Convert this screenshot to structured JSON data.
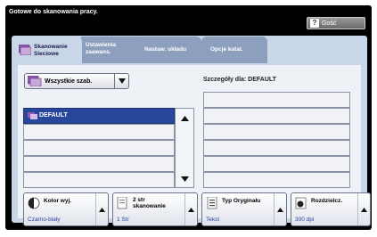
{
  "status_bar": {
    "message": "Gotowe do skanowania pracy.",
    "guest_button": "Gość",
    "guest_icon": "question-icon"
  },
  "tabs": [
    {
      "label_1": "Skanowanie",
      "label_2": "Sieciowe",
      "active": true
    },
    {
      "label_1": "Ustawienia",
      "label_2": "zaawans.",
      "active": false
    },
    {
      "label_1": "Nastaw. układu",
      "label_2": "",
      "active": false
    },
    {
      "label_1": "Opcje katal.",
      "label_2": "",
      "active": false
    }
  ],
  "template_dropdown": {
    "label": "Wszystkie szab."
  },
  "template_list": {
    "items": [
      "DEFAULT",
      "",
      "",
      "",
      ""
    ],
    "selected_index": 0
  },
  "details": {
    "title": "Szczegóły dla: DEFAULT",
    "rows": 6
  },
  "bottom_buttons": [
    {
      "title_1": "Kolor wyj.",
      "title_2": "",
      "title_3": "",
      "value": "Czarno-biały",
      "icon": "color-output-icon"
    },
    {
      "title_1": "2 str",
      "title_2": "skanowanie",
      "title_3": "",
      "value": "1 Str",
      "icon": "two-sided-icon"
    },
    {
      "title_1": "Typ Oryginału",
      "title_2": "",
      "title_3": "",
      "value": "Tekst",
      "icon": "original-type-icon"
    },
    {
      "title_1": "Rozdzielcz.",
      "title_2": "",
      "title_3": "",
      "value": "300 dpi",
      "icon": "resolution-icon"
    }
  ],
  "colors": {
    "selected_row": "#27469c",
    "panel": "#c9d6e8",
    "tab_inactive": "#8ca0bd"
  }
}
